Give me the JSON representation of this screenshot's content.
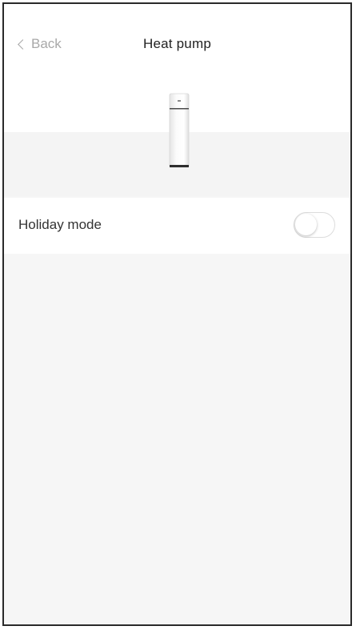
{
  "header": {
    "back_label": "Back",
    "title": "Heat pump"
  },
  "device": {
    "icon": "heat-pump-device-icon"
  },
  "settings": {
    "holiday_mode": {
      "label": "Holiday mode",
      "enabled": false
    }
  },
  "colors": {
    "background": "#f6f6f6",
    "surface": "#ffffff",
    "muted_text": "#a8a8a8",
    "text": "#333333"
  }
}
